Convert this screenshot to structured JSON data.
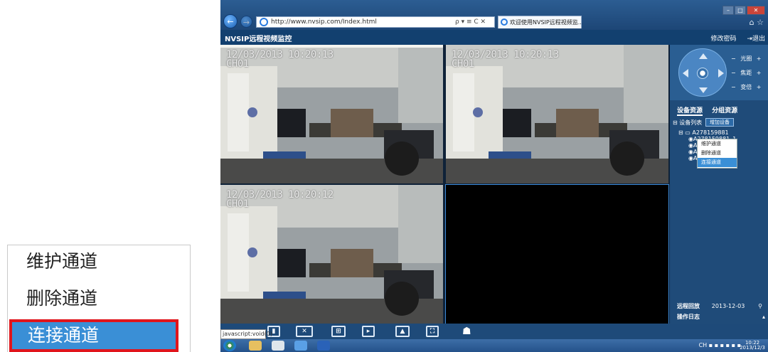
{
  "zoom_menu": {
    "items": [
      "维护通道",
      "删除通道",
      "连接通道"
    ],
    "selected_index": 2
  },
  "browser": {
    "url": "http://www.nvsip.com/Index.html",
    "tools": "ρ ▾ ≡ C ✕",
    "tab_title": "欢迎使用NVSIP远程视频监...",
    "tab_close": "×",
    "nav_back": "←",
    "nav_forward": "→"
  },
  "app": {
    "title": "NVSIP远程视频监控",
    "change_password": "修改密码",
    "logout": "退出"
  },
  "video": {
    "cells": [
      {
        "timestamp": "12/03/2013 10:20:13",
        "channel": "CH01",
        "has_feed": true
      },
      {
        "timestamp": "12/03/2013 10:20:13",
        "channel": "CH01",
        "has_feed": true
      },
      {
        "timestamp": "12/03/2013 10:20:12",
        "channel": "CH01",
        "has_feed": true
      },
      {
        "timestamp": "",
        "channel": "",
        "has_feed": false
      }
    ]
  },
  "ptz": {
    "rows": [
      {
        "minus": "−",
        "label": "光圈",
        "plus": "+"
      },
      {
        "minus": "−",
        "label": "焦距",
        "plus": "+"
      },
      {
        "minus": "−",
        "label": "变倍",
        "plus": "+"
      }
    ]
  },
  "resources": {
    "tabs": [
      "设备资源",
      "分组资源"
    ],
    "device_list_label": "设备列表",
    "add_device": "增加设备",
    "device_root": "A278159881",
    "channels": [
      "A278159881_1",
      "A279",
      "A279",
      "A279"
    ]
  },
  "context_menu": {
    "items": [
      "维护通道",
      "删除通道",
      "连接通道"
    ],
    "selected_index": 2
  },
  "bottom_panel": {
    "remote_playback": "远程回放",
    "date": "2013-12-03",
    "operation_log": "操作日志"
  },
  "status_bar": {
    "text": "javascript:void(0)"
  },
  "taskbar": {
    "time": "10:22",
    "date": "2013/12/3",
    "lang": "CH"
  },
  "colors": {
    "accent": "#3a8fd6",
    "highlight_border": "#e0151c",
    "header": "#12406f",
    "panel": "#1f4b79"
  }
}
